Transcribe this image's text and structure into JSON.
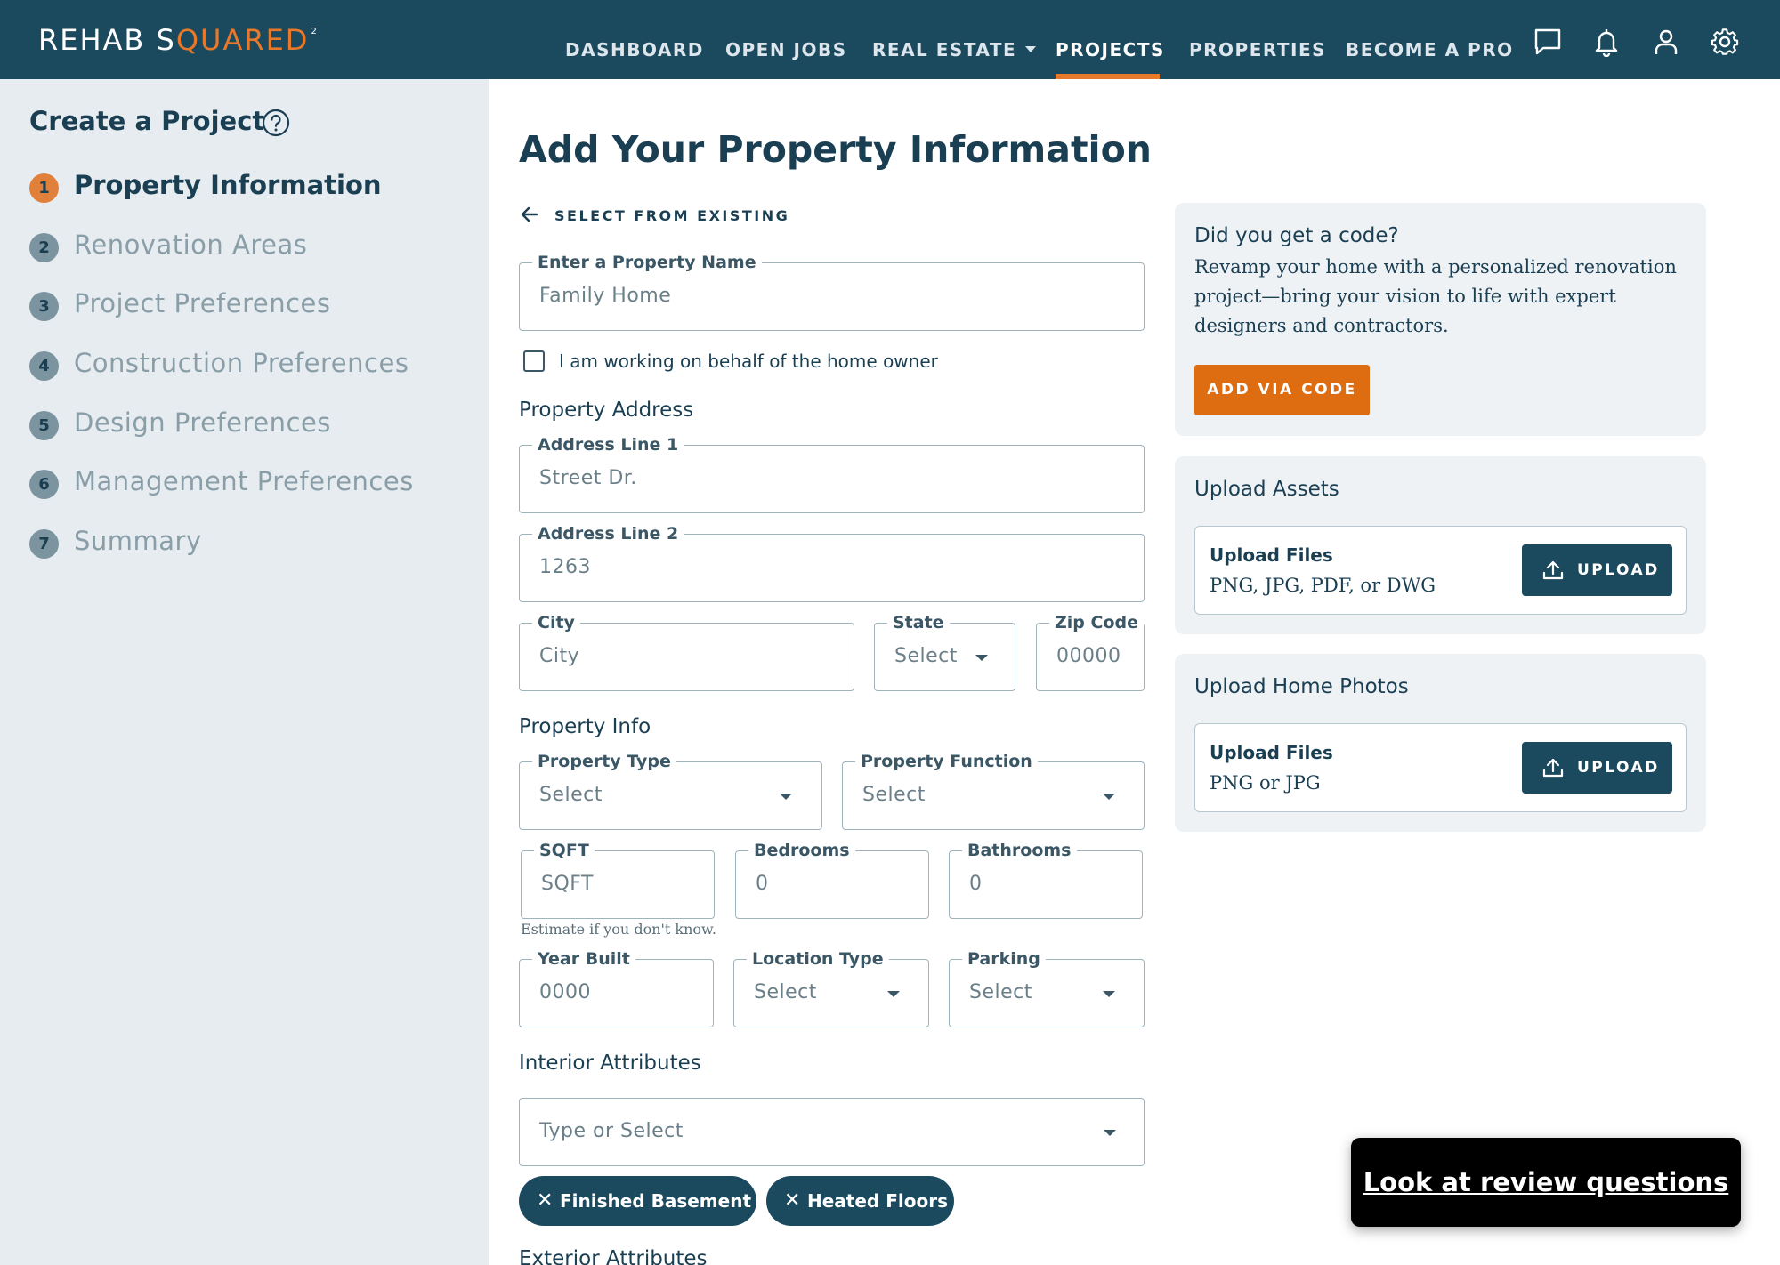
{
  "brand": {
    "name_part1": "REHAB S",
    "name_accent": "QUARED",
    "superscript": "2"
  },
  "nav": {
    "items": [
      {
        "label": "DASHBOARD"
      },
      {
        "label": "OPEN JOBS"
      },
      {
        "label": "REAL ESTATE"
      },
      {
        "label": "PROJECTS"
      },
      {
        "label": "PROPERTIES"
      },
      {
        "label": "BECOME A PRO"
      }
    ],
    "active": "PROJECTS",
    "icons": [
      "chat-icon",
      "bell-icon",
      "user-icon",
      "gear-icon"
    ]
  },
  "sidebar": {
    "title": "Create a Project",
    "steps": [
      {
        "num": "1",
        "label": "Property Information",
        "active": true
      },
      {
        "num": "2",
        "label": "Renovation Areas"
      },
      {
        "num": "3",
        "label": "Project Preferences"
      },
      {
        "num": "4",
        "label": "Construction Preferences"
      },
      {
        "num": "5",
        "label": "Design Preferences"
      },
      {
        "num": "6",
        "label": "Management Preferences"
      },
      {
        "num": "7",
        "label": "Summary"
      }
    ]
  },
  "form": {
    "title": "Add Your Property Information",
    "back_link": "SELECT FROM EXISTING",
    "property_name": {
      "label": "Enter a Property Name",
      "value": "Family Home"
    },
    "behalf_checkbox": {
      "label": "I am working on behalf of the home owner",
      "checked": false
    },
    "address_section": "Property Address",
    "address1": {
      "label": "Address Line 1",
      "value": "Street Dr."
    },
    "address2": {
      "label": "Address Line 2",
      "value": "1263"
    },
    "city": {
      "label": "City",
      "value": "City"
    },
    "state": {
      "label": "State",
      "value": "Select"
    },
    "zip": {
      "label": "Zip Code",
      "value": "00000"
    },
    "info_section": "Property Info",
    "property_type": {
      "label": "Property Type",
      "value": "Select"
    },
    "property_function": {
      "label": "Property Function",
      "value": "Select"
    },
    "sqft": {
      "label": "SQFT",
      "value": "SQFT"
    },
    "bedrooms": {
      "label": "Bedrooms",
      "value": "0"
    },
    "bathrooms": {
      "label": "Bathrooms",
      "value": "0"
    },
    "sqft_hint": "Estimate if you don't know.",
    "year_built": {
      "label": "Year Built",
      "value": "0000"
    },
    "location_type": {
      "label": "Location Type",
      "value": "Select"
    },
    "parking": {
      "label": "Parking",
      "value": "Select"
    },
    "interior_section": "Interior Attributes",
    "interior_select": {
      "value": "Type or Select"
    },
    "chips": [
      "Finished Basement",
      "Heated Floors"
    ],
    "exterior_section": "Exterior Attributes"
  },
  "code_card": {
    "title": "Did you get a code?",
    "text": "Revamp your home with a personalized renovation project—bring your vision to life with expert designers and contractors.",
    "button": "ADD VIA CODE"
  },
  "assets_card": {
    "title": "Upload Assets",
    "box_title": "Upload Files",
    "box_sub": "PNG, JPG, PDF, or DWG",
    "button": "UPLOAD"
  },
  "photos_card": {
    "title": "Upload Home Photos",
    "box_title": "Upload Files",
    "box_sub": "PNG or JPG",
    "button": "UPLOAD"
  },
  "review": {
    "label": "Look at review questions"
  },
  "colors": {
    "nav_bg": "#1b4a5f",
    "accent": "#e8782a",
    "button_orange": "#de6d11",
    "sidebar_bg": "#e6ecf0",
    "text_dark": "#1a3e52"
  }
}
